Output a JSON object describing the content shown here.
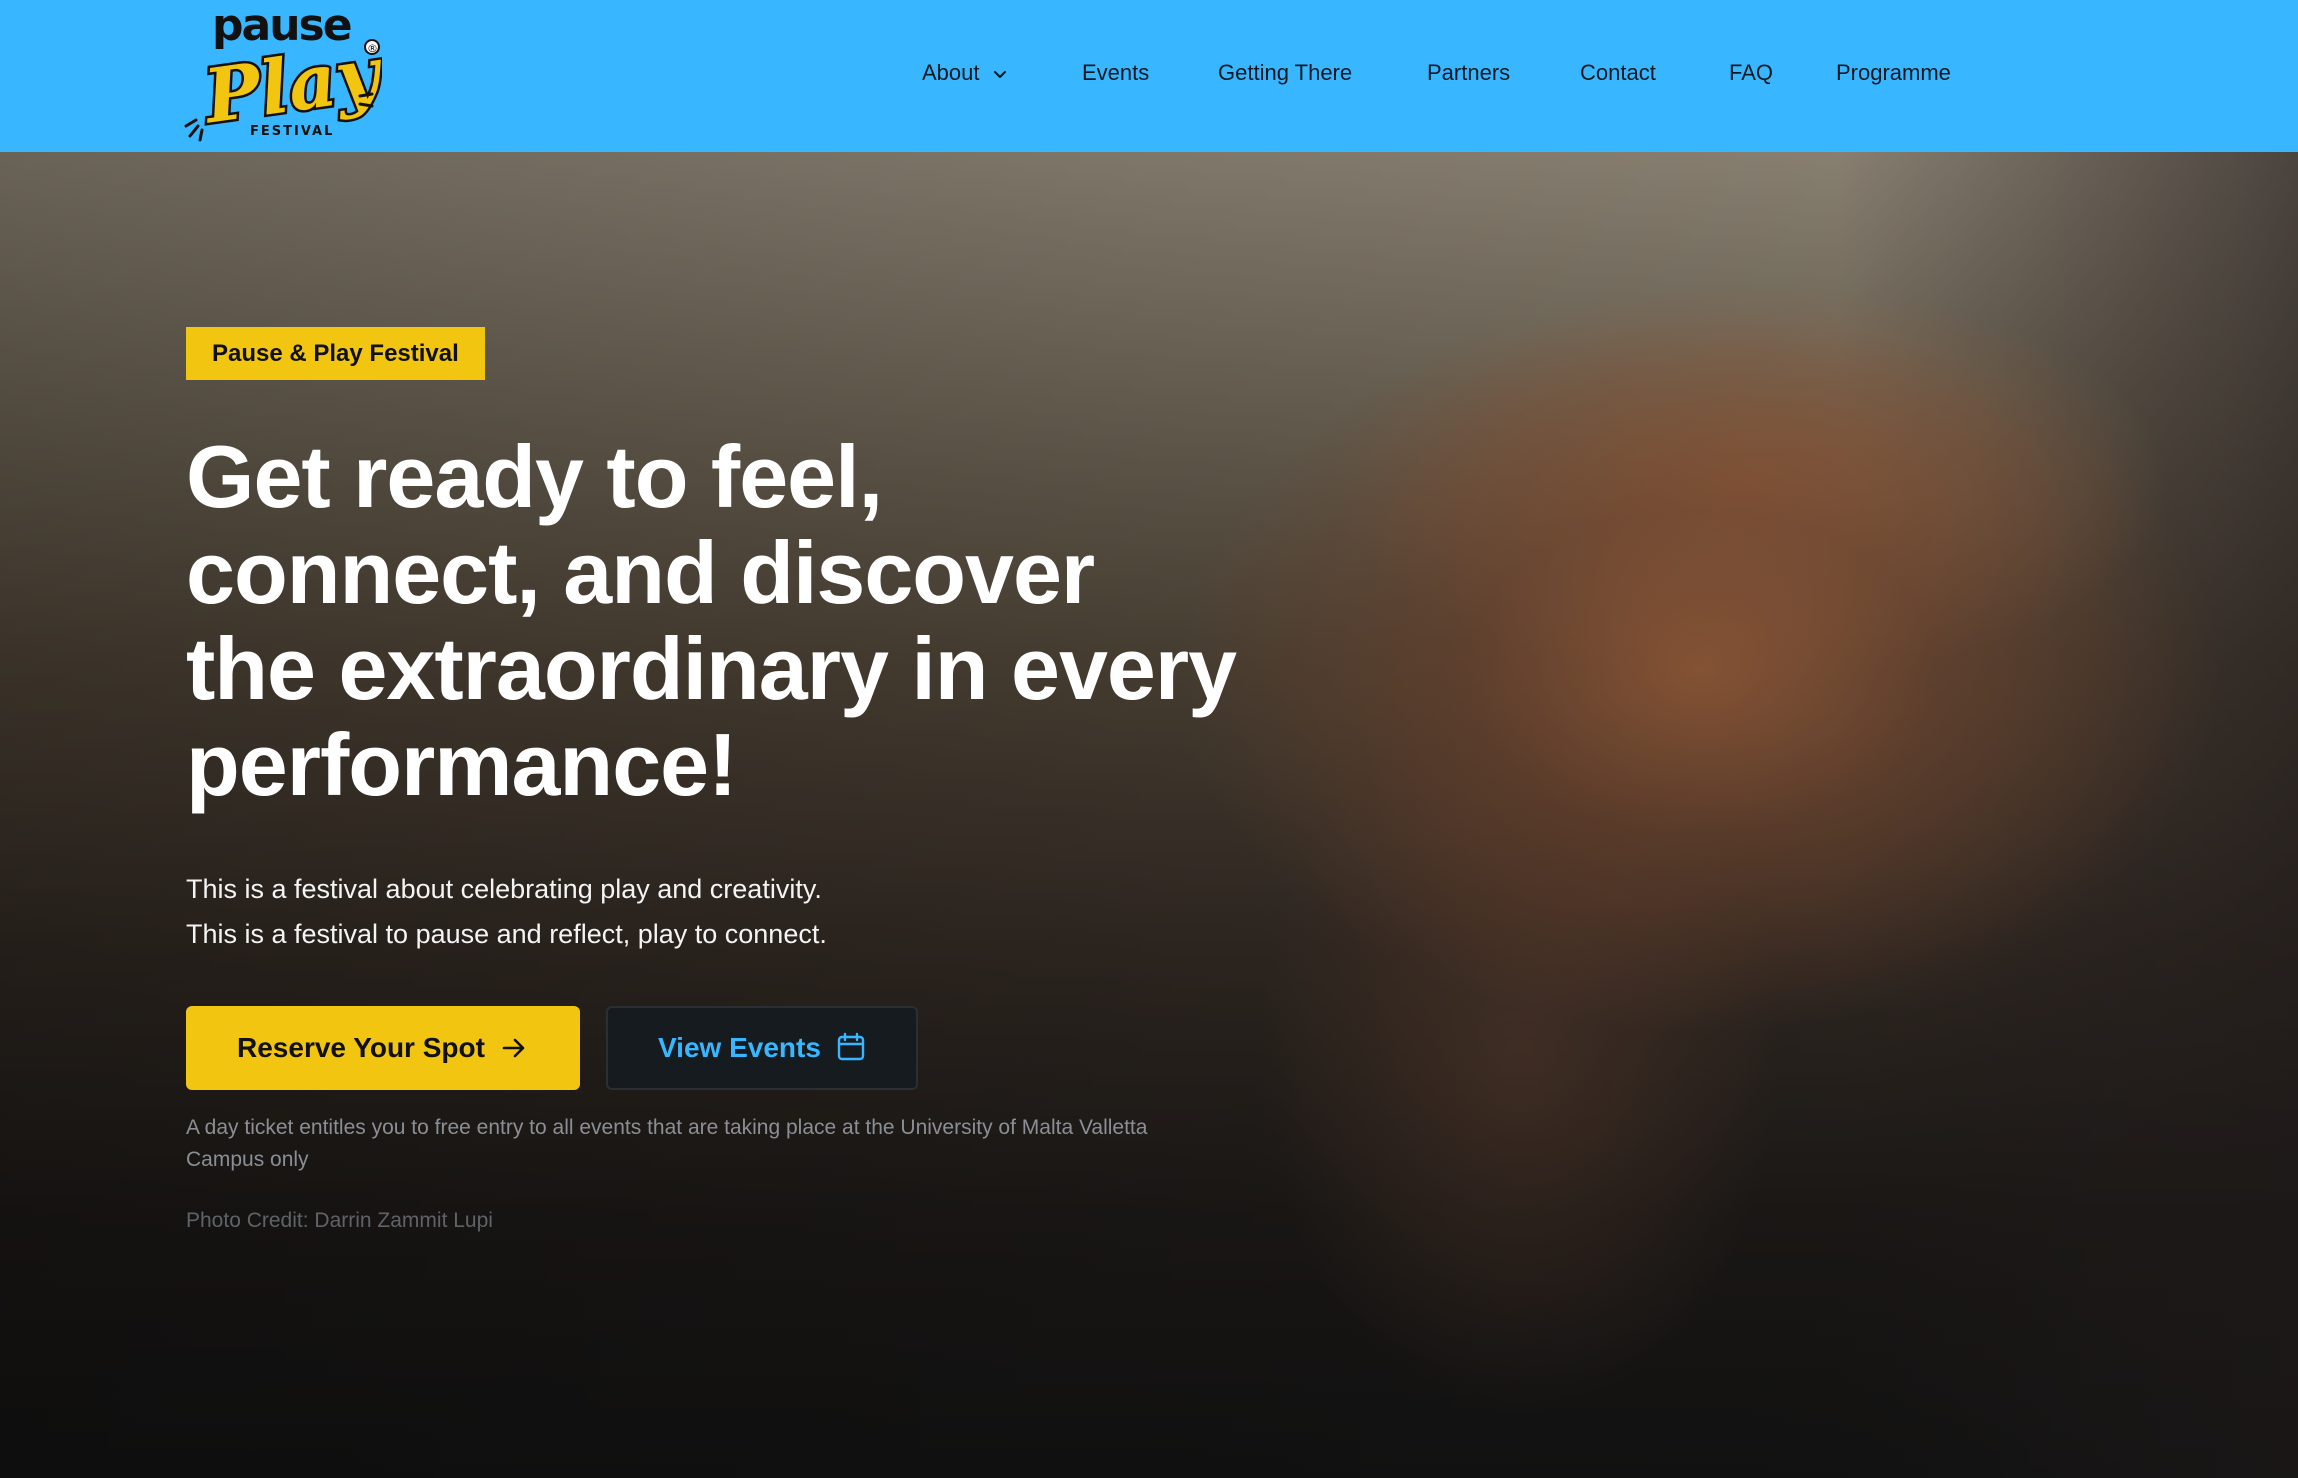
{
  "header": {
    "logo": {
      "word_top": "pause",
      "word_main": "Play",
      "word_sub": "FESTIVAL",
      "mark": "®"
    },
    "nav": [
      {
        "label": "About",
        "has_dropdown": true
      },
      {
        "label": "Events"
      },
      {
        "label": "Getting There"
      },
      {
        "label": "Partners"
      },
      {
        "label": "Contact"
      },
      {
        "label": "FAQ"
      },
      {
        "label": "Programme"
      }
    ]
  },
  "hero": {
    "badge": "Pause & Play Festival",
    "headline": "Get ready to feel, connect, and discover the extraordinary in every performance!",
    "subtext": [
      "This is a festival about celebrating play and creativity.",
      "This is a festival to pause and reflect, play to connect."
    ],
    "primary_button": {
      "label": "Reserve Your Spot",
      "icon": "arrow-right-icon"
    },
    "secondary_button": {
      "label": "View Events",
      "icon": "calendar-icon"
    },
    "note": "A day ticket entitles you to free entry to all events that are taking place at the University of Malta Valletta Campus only",
    "credit": "Photo Credit: Darrin Zammit Lupi"
  },
  "colors": {
    "header_bg": "#38b6ff",
    "accent_yellow": "#f2c511",
    "accent_blue": "#38b6ff",
    "dark_button": "#161b1f"
  }
}
